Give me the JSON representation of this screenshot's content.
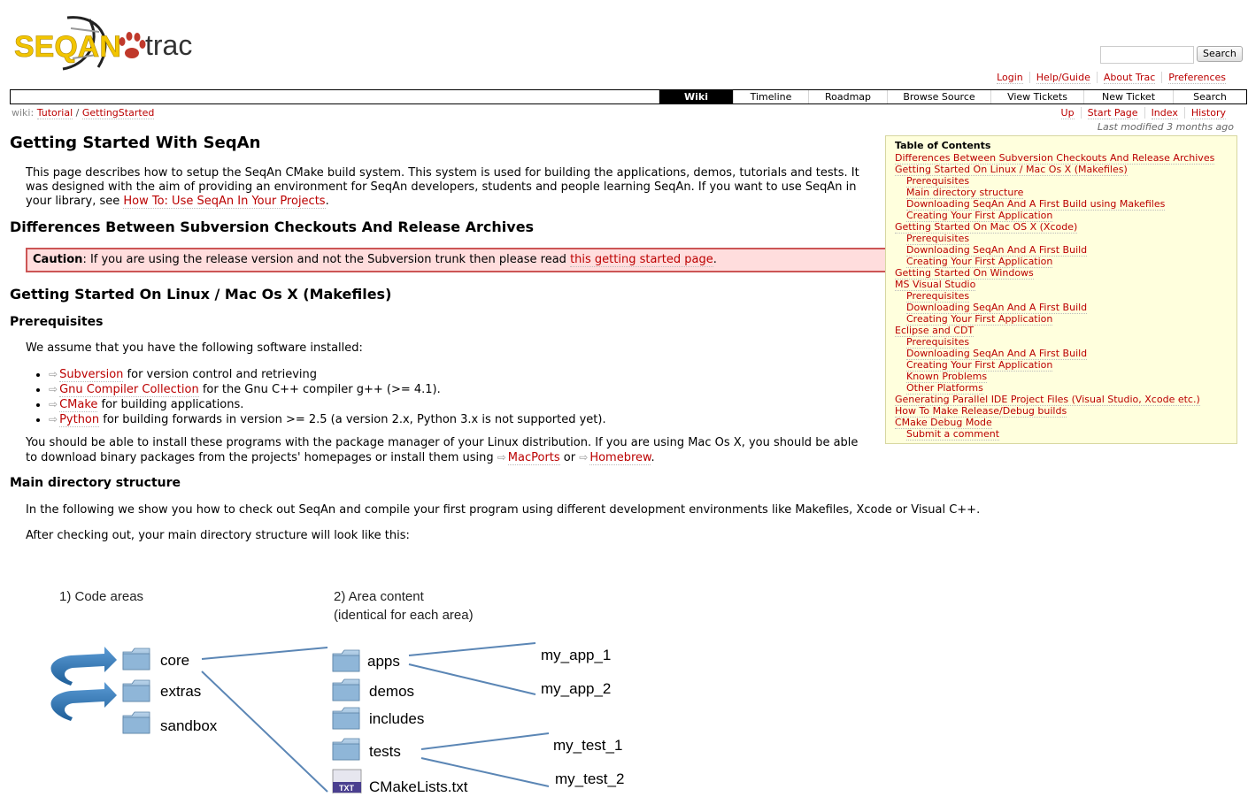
{
  "logo": {
    "brand": "SEQAN",
    "product": "trac"
  },
  "search": {
    "button": "Search",
    "placeholder": ""
  },
  "metanav": [
    "Login",
    "Help/Guide",
    "About Trac",
    "Preferences"
  ],
  "mainnav": [
    "Wiki",
    "Timeline",
    "Roadmap",
    "Browse Source",
    "View Tickets",
    "New Ticket",
    "Search"
  ],
  "breadcrumb": {
    "prefix": "wiki:",
    "items": [
      "Tutorial",
      "/",
      "GettingStarted"
    ]
  },
  "ctxnav": [
    "Up",
    "Start Page",
    "Index",
    "History"
  ],
  "last_modified": "Last modified 3 months ago",
  "page_title": "Getting Started With SeqAn",
  "intro": {
    "text": "This page describes how to setup the SeqAn CMake build system. This system is used for building the applications, demos, tutorials and tests. It was designed with the aim of providing an environment for SeqAn developers, students and people learning SeqAn. If you want to use SeqAn in your library, see ",
    "link": "How To: Use SeqAn In Your Projects",
    "end": "."
  },
  "sec_differences": "Differences Between Subversion Checkouts And Release Archives",
  "caution": {
    "label": "Caution",
    "text": ": If you are using the release version and not the Subversion trunk then please read ",
    "link": "this getting started page",
    "end": "."
  },
  "sec_linux": "Getting Started On Linux / Mac Os X (Makefiles)",
  "sec_prereq": "Prerequisites",
  "prereq_intro": "We assume that you have the following software installed:",
  "software": [
    {
      "link": "Subversion",
      "text": " for version control and retrieving"
    },
    {
      "link": "Gnu Compiler Collection",
      "text": " for the Gnu C++ compiler g++ (>= 4.1)."
    },
    {
      "link": "CMake",
      "text": " for building applications."
    },
    {
      "link": "Python",
      "text": " for building forwards in version >= 2.5 (a version 2.x, Python 3.x is not supported yet)."
    }
  ],
  "install_para": {
    "text": "You should be able to install these programs with the package manager of your Linux distribution. If you are using Mac Os X, you should be able to download binary packages from the projects' homepages or install them using ",
    "link1": "MacPorts",
    "mid": " or ",
    "link2": "Homebrew",
    "end": "."
  },
  "sec_maindir": "Main directory structure",
  "maindir_para1": "In the following we show you how to check out SeqAn and compile your first program using different development environments like Makefiles, Xcode or Visual C++.",
  "maindir_para2": "After checking out, your main directory structure will look like this:",
  "toc": {
    "title": "Table of Contents",
    "items": [
      {
        "level": 1,
        "label": "Differences Between Subversion Checkouts And Release Archives"
      },
      {
        "level": 1,
        "label": "Getting Started On Linux / Mac Os X (Makefiles)"
      },
      {
        "level": 2,
        "label": "Prerequisites"
      },
      {
        "level": 2,
        "label": "Main directory structure"
      },
      {
        "level": 2,
        "label": "Downloading SeqAn And A First Build using Makefiles"
      },
      {
        "level": 2,
        "label": "Creating Your First Application"
      },
      {
        "level": 1,
        "label": "Getting Started On Mac OS X (Xcode)"
      },
      {
        "level": 2,
        "label": "Prerequisites"
      },
      {
        "level": 2,
        "label": "Downloading SeqAn And A First Build"
      },
      {
        "level": 2,
        "label": "Creating Your First Application"
      },
      {
        "level": 1,
        "label": "Getting Started On Windows"
      },
      {
        "level": 1,
        "label": "MS Visual Studio"
      },
      {
        "level": 2,
        "label": "Prerequisites"
      },
      {
        "level": 2,
        "label": "Downloading SeqAn And A First Build"
      },
      {
        "level": 2,
        "label": "Creating Your First Application"
      },
      {
        "level": 1,
        "label": "Eclipse and CDT"
      },
      {
        "level": 2,
        "label": "Prerequisites"
      },
      {
        "level": 2,
        "label": "Downloading SeqAn And A First Build"
      },
      {
        "level": 2,
        "label": "Creating Your First Application"
      },
      {
        "level": 2,
        "label": "Known Problems"
      },
      {
        "level": 2,
        "label": "Other Platforms"
      },
      {
        "level": 1,
        "label": "Generating Parallel IDE Project Files (Visual Studio, Xcode etc.)"
      },
      {
        "level": 1,
        "label": "How To Make Release/Debug builds"
      },
      {
        "level": 1,
        "label": "CMake Debug Mode"
      },
      {
        "level": 2,
        "label": "Submit a comment"
      }
    ]
  },
  "diagram": {
    "heading1": "1) Code areas",
    "heading2a": "2) Area content",
    "heading2b": "(identical for each area)",
    "areas": [
      "core",
      "extras",
      "sandbox"
    ],
    "contents": [
      "apps",
      "demos",
      "includes",
      "tests",
      "CMakeLists.txt"
    ],
    "apps": [
      "my_app_1",
      "my_app_2"
    ],
    "tests": [
      "my_test_1",
      "my_test_2"
    ],
    "file_badge": "TXT"
  },
  "colors": {
    "link": "#bb0000",
    "caution_bg": "#ffdddd",
    "toc_bg": "#ffffdd",
    "logo_yellow": "#f2c500",
    "logo_red": "#c0392b"
  }
}
